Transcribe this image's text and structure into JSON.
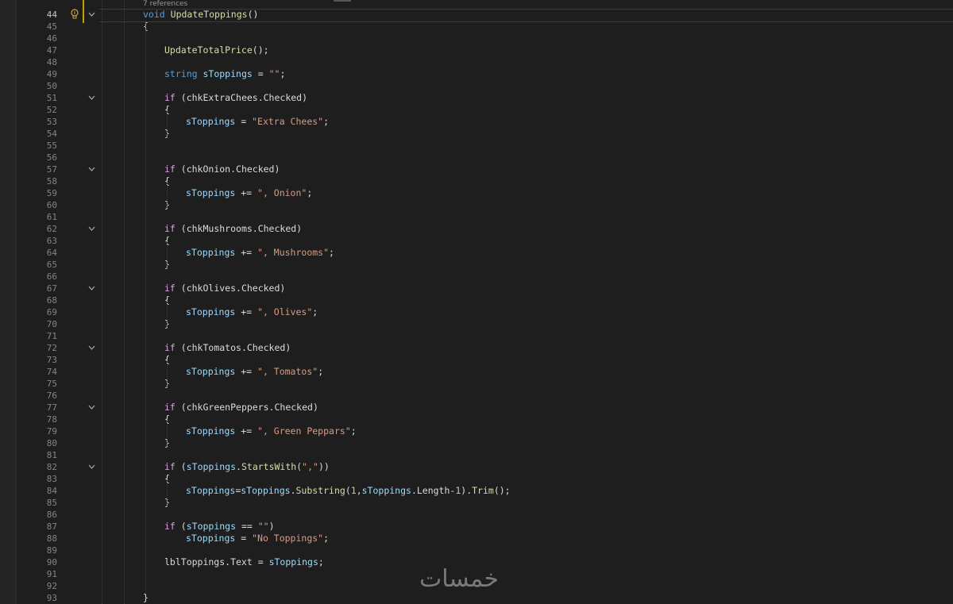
{
  "editor": {
    "codelens_references": "7 references",
    "current_line": 44,
    "lines": [
      {
        "n": 44,
        "indent": 2,
        "fold": true,
        "tokens": [
          [
            "kw",
            "void"
          ],
          [
            "plain",
            " "
          ],
          [
            "fn",
            "UpdateToppings"
          ],
          [
            "plain",
            "()"
          ]
        ]
      },
      {
        "n": 45,
        "indent": 2,
        "tokens": [
          [
            "plain",
            "{"
          ]
        ]
      },
      {
        "n": 46,
        "indent": 0,
        "tokens": []
      },
      {
        "n": 47,
        "indent": 3,
        "tokens": [
          [
            "fn",
            "UpdateTotalPrice"
          ],
          [
            "plain",
            "();"
          ]
        ]
      },
      {
        "n": 48,
        "indent": 0,
        "tokens": []
      },
      {
        "n": 49,
        "indent": 3,
        "tokens": [
          [
            "kw",
            "string"
          ],
          [
            "plain",
            " "
          ],
          [
            "var",
            "sToppings"
          ],
          [
            "plain",
            " = "
          ],
          [
            "str",
            "\"\""
          ],
          [
            "plain",
            ";"
          ]
        ]
      },
      {
        "n": 50,
        "indent": 0,
        "tokens": []
      },
      {
        "n": 51,
        "indent": 3,
        "fold": true,
        "tokens": [
          [
            "ctl",
            "if"
          ],
          [
            "plain",
            " (chkExtraChees.Checked)"
          ]
        ]
      },
      {
        "n": 52,
        "indent": 3,
        "tokens": [
          [
            "plain",
            "{"
          ]
        ]
      },
      {
        "n": 53,
        "indent": 4,
        "tokens": [
          [
            "var",
            "sToppings"
          ],
          [
            "plain",
            " = "
          ],
          [
            "str",
            "\"Extra Chees\""
          ],
          [
            "plain",
            ";"
          ]
        ]
      },
      {
        "n": 54,
        "indent": 3,
        "tokens": [
          [
            "plain",
            "}"
          ]
        ]
      },
      {
        "n": 55,
        "indent": 0,
        "tokens": []
      },
      {
        "n": 56,
        "indent": 0,
        "tokens": []
      },
      {
        "n": 57,
        "indent": 3,
        "fold": true,
        "tokens": [
          [
            "ctl",
            "if"
          ],
          [
            "plain",
            " (chkOnion.Checked)"
          ]
        ]
      },
      {
        "n": 58,
        "indent": 3,
        "tokens": [
          [
            "plain",
            "{"
          ]
        ]
      },
      {
        "n": 59,
        "indent": 4,
        "tokens": [
          [
            "var",
            "sToppings"
          ],
          [
            "plain",
            " += "
          ],
          [
            "str",
            "\", Onion\""
          ],
          [
            "plain",
            ";"
          ]
        ]
      },
      {
        "n": 60,
        "indent": 3,
        "tokens": [
          [
            "plain",
            "}"
          ]
        ]
      },
      {
        "n": 61,
        "indent": 0,
        "tokens": []
      },
      {
        "n": 62,
        "indent": 3,
        "fold": true,
        "tokens": [
          [
            "ctl",
            "if"
          ],
          [
            "plain",
            " (chkMushrooms.Checked)"
          ]
        ]
      },
      {
        "n": 63,
        "indent": 3,
        "tokens": [
          [
            "plain",
            "{"
          ]
        ]
      },
      {
        "n": 64,
        "indent": 4,
        "tokens": [
          [
            "var",
            "sToppings"
          ],
          [
            "plain",
            " += "
          ],
          [
            "str",
            "\", Mushrooms\""
          ],
          [
            "plain",
            ";"
          ]
        ]
      },
      {
        "n": 65,
        "indent": 3,
        "tokens": [
          [
            "plain",
            "}"
          ]
        ]
      },
      {
        "n": 66,
        "indent": 0,
        "tokens": []
      },
      {
        "n": 67,
        "indent": 3,
        "fold": true,
        "tokens": [
          [
            "ctl",
            "if"
          ],
          [
            "plain",
            " (chkOlives.Checked)"
          ]
        ]
      },
      {
        "n": 68,
        "indent": 3,
        "tokens": [
          [
            "plain",
            "{"
          ]
        ]
      },
      {
        "n": 69,
        "indent": 4,
        "tokens": [
          [
            "var",
            "sToppings"
          ],
          [
            "plain",
            " += "
          ],
          [
            "str",
            "\", Olives\""
          ],
          [
            "plain",
            ";"
          ]
        ]
      },
      {
        "n": 70,
        "indent": 3,
        "tokens": [
          [
            "plain",
            "}"
          ]
        ]
      },
      {
        "n": 71,
        "indent": 0,
        "tokens": []
      },
      {
        "n": 72,
        "indent": 3,
        "fold": true,
        "tokens": [
          [
            "ctl",
            "if"
          ],
          [
            "plain",
            " (chkTomatos.Checked)"
          ]
        ]
      },
      {
        "n": 73,
        "indent": 3,
        "tokens": [
          [
            "plain",
            "{"
          ]
        ]
      },
      {
        "n": 74,
        "indent": 4,
        "tokens": [
          [
            "var",
            "sToppings"
          ],
          [
            "plain",
            " += "
          ],
          [
            "str",
            "\", Tomatos\""
          ],
          [
            "plain",
            ";"
          ]
        ]
      },
      {
        "n": 75,
        "indent": 3,
        "tokens": [
          [
            "plain",
            "}"
          ]
        ]
      },
      {
        "n": 76,
        "indent": 0,
        "tokens": []
      },
      {
        "n": 77,
        "indent": 3,
        "fold": true,
        "tokens": [
          [
            "ctl",
            "if"
          ],
          [
            "plain",
            " (chkGreenPeppers.Checked)"
          ]
        ]
      },
      {
        "n": 78,
        "indent": 3,
        "tokens": [
          [
            "plain",
            "{"
          ]
        ]
      },
      {
        "n": 79,
        "indent": 4,
        "tokens": [
          [
            "var",
            "sToppings"
          ],
          [
            "plain",
            " += "
          ],
          [
            "str",
            "\", Green Peppars\""
          ],
          [
            "plain",
            ";"
          ]
        ]
      },
      {
        "n": 80,
        "indent": 3,
        "tokens": [
          [
            "plain",
            "}"
          ]
        ]
      },
      {
        "n": 81,
        "indent": 0,
        "tokens": []
      },
      {
        "n": 82,
        "indent": 3,
        "fold": true,
        "tokens": [
          [
            "ctl",
            "if"
          ],
          [
            "plain",
            " ("
          ],
          [
            "var",
            "sToppings"
          ],
          [
            "plain",
            "."
          ],
          [
            "fn",
            "StartsWith"
          ],
          [
            "plain",
            "("
          ],
          [
            "str",
            "\",\""
          ],
          [
            "plain",
            "))"
          ]
        ]
      },
      {
        "n": 83,
        "indent": 3,
        "tokens": [
          [
            "plain",
            "{"
          ]
        ]
      },
      {
        "n": 84,
        "indent": 4,
        "tokens": [
          [
            "var",
            "sToppings"
          ],
          [
            "plain",
            "="
          ],
          [
            "var",
            "sToppings"
          ],
          [
            "plain",
            "."
          ],
          [
            "fn",
            "Substring"
          ],
          [
            "plain",
            "("
          ],
          [
            "num",
            "1"
          ],
          [
            "plain",
            ","
          ],
          [
            "var",
            "sToppings"
          ],
          [
            "plain",
            ".Length-"
          ],
          [
            "num",
            "1"
          ],
          [
            "plain",
            ")."
          ],
          [
            "fn",
            "Trim"
          ],
          [
            "plain",
            "();"
          ]
        ]
      },
      {
        "n": 85,
        "indent": 3,
        "tokens": [
          [
            "plain",
            "}"
          ]
        ]
      },
      {
        "n": 86,
        "indent": 0,
        "tokens": []
      },
      {
        "n": 87,
        "indent": 3,
        "tokens": [
          [
            "ctl",
            "if"
          ],
          [
            "plain",
            " ("
          ],
          [
            "var",
            "sToppings"
          ],
          [
            "plain",
            " == "
          ],
          [
            "str",
            "\"\""
          ],
          [
            "plain",
            ")"
          ]
        ]
      },
      {
        "n": 88,
        "indent": 4,
        "tokens": [
          [
            "var",
            "sToppings"
          ],
          [
            "plain",
            " = "
          ],
          [
            "str",
            "\"No Toppings\""
          ],
          [
            "plain",
            ";"
          ]
        ]
      },
      {
        "n": 89,
        "indent": 0,
        "tokens": []
      },
      {
        "n": 90,
        "indent": 3,
        "tokens": [
          [
            "plain",
            "lblToppings.Text = "
          ],
          [
            "var",
            "sToppings"
          ],
          [
            "plain",
            ";"
          ]
        ]
      },
      {
        "n": 91,
        "indent": 0,
        "tokens": []
      },
      {
        "n": 92,
        "indent": 0,
        "tokens": []
      },
      {
        "n": 93,
        "indent": 2,
        "tokens": [
          [
            "plain",
            "}"
          ]
        ]
      }
    ]
  },
  "watermark_text": "خمسات",
  "colors": {
    "background": "#1e1e1e",
    "keyword": "#569cd6",
    "control": "#d8a0df",
    "function": "#dcdcaa",
    "string": "#d69d85",
    "variable": "#9cdcfe",
    "number": "#b5cea8",
    "line_number": "#858585"
  }
}
